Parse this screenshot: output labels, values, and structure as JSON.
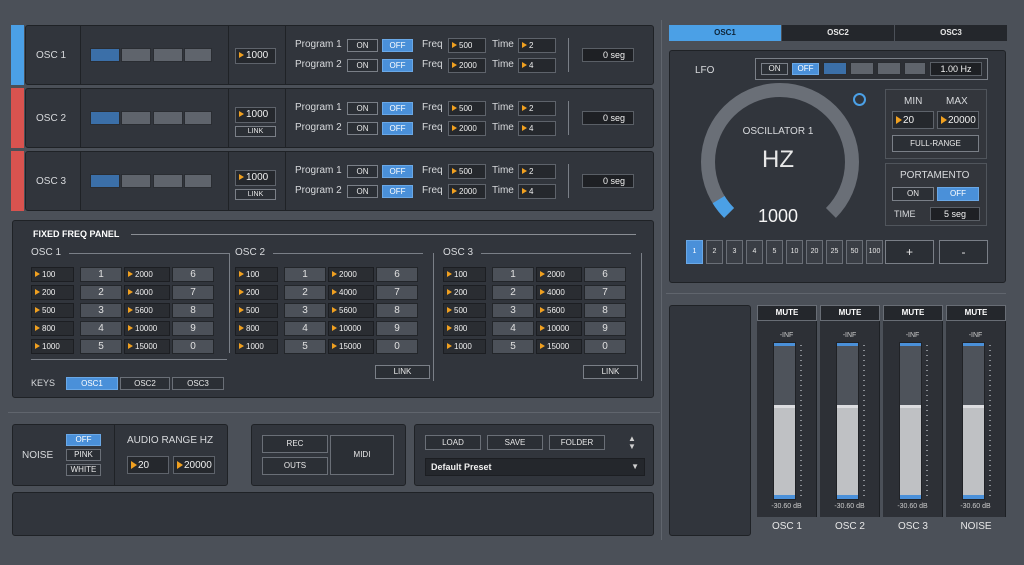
{
  "oscillators": [
    {
      "label": "OSC 1",
      "color": "#4ba0e6",
      "value": "1000",
      "link": "",
      "p1": {
        "label": "Program 1",
        "freq": "500",
        "time": "2"
      },
      "p2": {
        "label": "Program 2",
        "freq": "2000",
        "time": "4"
      },
      "display": "0 seg"
    },
    {
      "label": "OSC 2",
      "color": "#d9534f",
      "value": "1000",
      "link": "LINK",
      "p1": {
        "label": "Program 1",
        "freq": "500",
        "time": "2"
      },
      "p2": {
        "label": "Program 2",
        "freq": "2000",
        "time": "4"
      },
      "display": "0 seg"
    },
    {
      "label": "OSC 3",
      "color": "#d9534f",
      "value": "1000",
      "link": "LINK",
      "p1": {
        "label": "Program 1",
        "freq": "500",
        "time": "2"
      },
      "p2": {
        "label": "Program 2",
        "freq": "2000",
        "time": "4"
      },
      "display": "0 seg"
    }
  ],
  "common": {
    "on": "ON",
    "off": "OFF",
    "freq": "Freq",
    "time": "Time"
  },
  "fixed_panel": {
    "title": "FIXED FREQ PANEL",
    "groups": [
      {
        "label": "OSC 1",
        "link": ""
      },
      {
        "label": "OSC 2",
        "link": "LINK"
      },
      {
        "label": "OSC 3",
        "link": "LINK"
      }
    ],
    "left_values": [
      "100",
      "200",
      "500",
      "800",
      "1000"
    ],
    "left_keys": [
      "1",
      "2",
      "3",
      "4",
      "5"
    ],
    "right_values": [
      "2000",
      "4000",
      "5600",
      "10000",
      "15000"
    ],
    "right_keys": [
      "6",
      "7",
      "8",
      "9",
      "0"
    ],
    "keys_label": "KEYS",
    "keys": [
      "OSC1",
      "OSC2",
      "OSC3"
    ]
  },
  "noise": {
    "label": "NOISE",
    "options": [
      "OFF",
      "PINK",
      "WHITE"
    ]
  },
  "audio_range": {
    "label": "AUDIO RANGE HZ",
    "min": "20",
    "max": "20000"
  },
  "rec_panel": {
    "rec": "REC",
    "outs": "OUTS",
    "midi": "MIDI"
  },
  "preset": {
    "load": "LOAD",
    "save": "SAVE",
    "folder": "FOLDER",
    "name": "Default Preset"
  },
  "tabs": [
    "OSC1",
    "OSC2",
    "OSC3"
  ],
  "right_panel": {
    "lfo_label": "LFO",
    "lfo_value": "1.00 Hz",
    "dial_title": "OSCILLATOR 1",
    "dial_unit": "HZ",
    "dial_value": "1000",
    "dial_level": 0.05,
    "min_label": "MIN",
    "max_label": "MAX",
    "min_value": "20",
    "max_value": "20000",
    "full_range": "FULL-RANGE",
    "portamento": "PORTAMENTO",
    "time_label": "TIME",
    "time_value": "5 seg",
    "steps": [
      "1",
      "2",
      "3",
      "4",
      "5",
      "10",
      "20",
      "25",
      "50",
      "100"
    ],
    "plus": "+",
    "minus": "-"
  },
  "mixer": {
    "mute": "MUTE",
    "inf": "-INF",
    "channels": [
      {
        "label": "OSC 1",
        "db": "-30.60 dB",
        "level": 0.6
      },
      {
        "label": "OSC 2",
        "db": "-30.60 dB",
        "level": 0.6
      },
      {
        "label": "OSC 3",
        "db": "-30.60 dB",
        "level": 0.6
      },
      {
        "label": "NOISE",
        "db": "-30.60 dB",
        "level": 0.6
      }
    ]
  },
  "colors": {
    "accent": "#4a90d9",
    "arrow": "#f0a020",
    "osc1": "#4ba0e6",
    "osc_alert": "#d9534f"
  }
}
